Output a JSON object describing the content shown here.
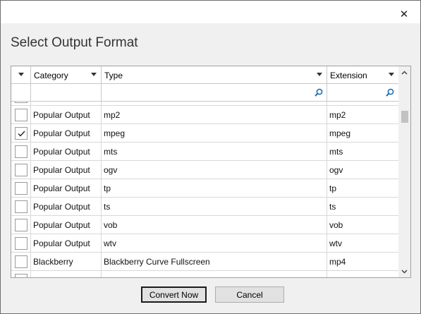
{
  "dialog": {
    "title": "Select Output Format",
    "close_glyph": "✕"
  },
  "grid": {
    "columns": [
      {
        "key": "select",
        "label": ""
      },
      {
        "key": "category",
        "label": "Category"
      },
      {
        "key": "type",
        "label": "Type"
      },
      {
        "key": "extension",
        "label": "Extension"
      }
    ],
    "filters": {
      "type": "",
      "extension": ""
    },
    "rows": [
      {
        "checked": false,
        "category": "",
        "type": "",
        "extension": "",
        "partial": true
      },
      {
        "checked": false,
        "category": "Popular Output",
        "type": "mp2",
        "extension": "mp2"
      },
      {
        "checked": true,
        "category": "Popular Output",
        "type": "mpeg",
        "extension": "mpeg"
      },
      {
        "checked": false,
        "category": "Popular Output",
        "type": "mts",
        "extension": "mts"
      },
      {
        "checked": false,
        "category": "Popular Output",
        "type": "ogv",
        "extension": "ogv"
      },
      {
        "checked": false,
        "category": "Popular Output",
        "type": "tp",
        "extension": "tp"
      },
      {
        "checked": false,
        "category": "Popular Output",
        "type": "ts",
        "extension": "ts"
      },
      {
        "checked": false,
        "category": "Popular Output",
        "type": "vob",
        "extension": "vob"
      },
      {
        "checked": false,
        "category": "Popular Output",
        "type": "wtv",
        "extension": "wtv"
      },
      {
        "checked": false,
        "category": "Blackberry",
        "type": "Blackberry Curve Fullscreen",
        "extension": "mp4"
      },
      {
        "checked": false,
        "category": "",
        "type": "",
        "extension": "",
        "partial": true
      }
    ],
    "scroll_position": 0.2
  },
  "buttons": {
    "convert": "Convert Now",
    "cancel": "Cancel"
  },
  "colors": {
    "accent_icon": "#1f6fb5",
    "window_bg": "#f0f0f0",
    "grid_border": "#a0a0a0"
  }
}
